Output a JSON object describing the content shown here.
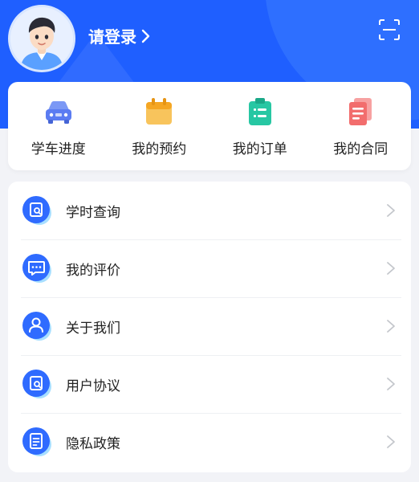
{
  "header": {
    "login_text": "请登录",
    "icons": {
      "avatar": "user-avatar",
      "scan": "scan-icon",
      "chevron": "chevron-right-icon"
    }
  },
  "quick_actions": [
    {
      "label": "学车进度",
      "icon": "car-icon",
      "color": "#5b7cf2"
    },
    {
      "label": "我的预约",
      "icon": "calendar-icon",
      "color": "#f5b23a"
    },
    {
      "label": "我的订单",
      "icon": "clipboard-icon",
      "color": "#27c7a3"
    },
    {
      "label": "我的合同",
      "icon": "document-stack-icon",
      "color": "#f26d6d"
    }
  ],
  "menu": [
    {
      "label": "学时查询",
      "icon": "search-document-icon"
    },
    {
      "label": "我的评价",
      "icon": "comment-icon"
    },
    {
      "label": "关于我们",
      "icon": "user-icon"
    },
    {
      "label": "用户协议",
      "icon": "search-document-icon"
    },
    {
      "label": "隐私政策",
      "icon": "document-icon"
    }
  ],
  "colors": {
    "header_bg": "#1f5fff",
    "menu_icon": "#2f6bff",
    "menu_icon_accent": "#6ec9ff",
    "page_bg": "#f2f3f7"
  }
}
